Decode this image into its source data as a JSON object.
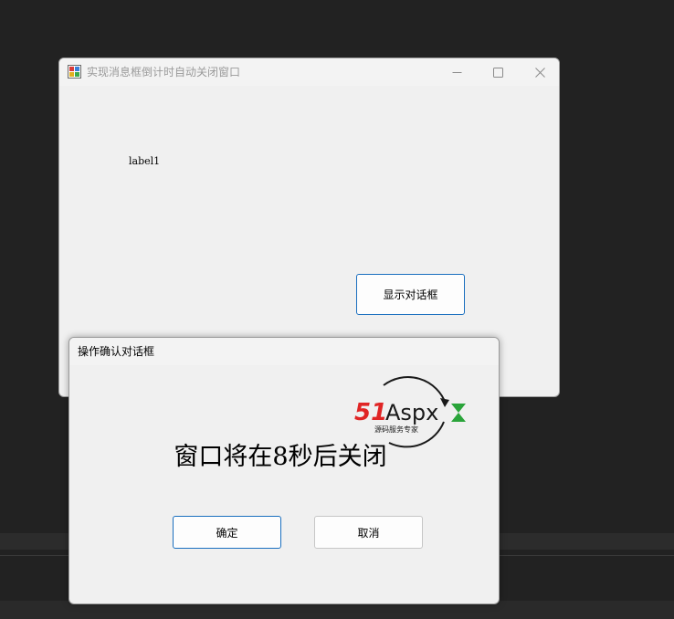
{
  "main_window": {
    "title": "实现消息框倒计时自动关闭窗口",
    "label1": "label1",
    "show_dialog_button": "显示对话框"
  },
  "dialog": {
    "title": "操作确认对话框",
    "countdown_message": "窗口将在8秒后关闭",
    "ok_button": "确定",
    "cancel_button": "取消"
  },
  "watermark": {
    "brand": "51Aspx",
    "tagline": "源码服务专家"
  },
  "icons": {
    "app": "app-icon",
    "minimize": "minimize-icon",
    "maximize": "maximize-icon",
    "close": "close-icon"
  },
  "colors": {
    "background": "#222222",
    "window": "#f0f0f0",
    "accent_border": "#1a6fbf",
    "logo_red": "#e02525",
    "logo_green": "#2aa43a"
  }
}
